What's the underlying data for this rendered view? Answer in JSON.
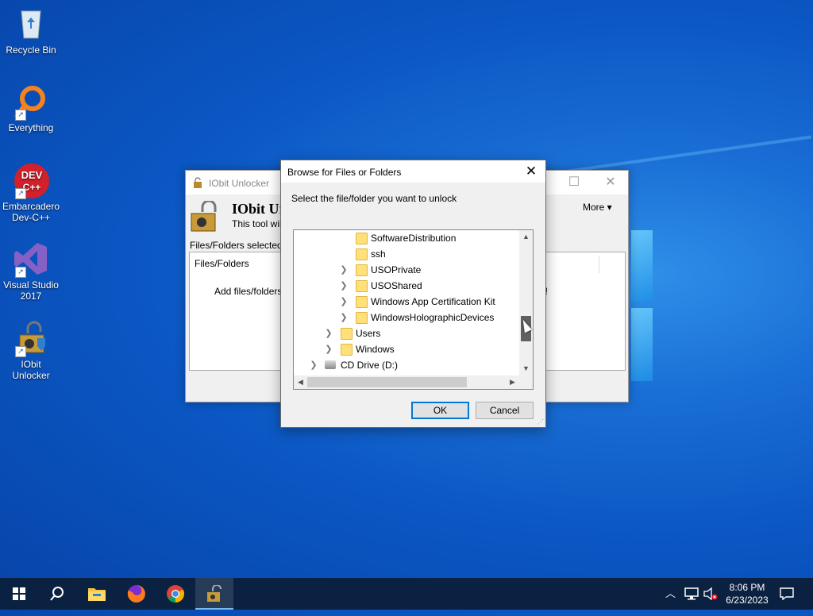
{
  "desktop": {
    "icons": [
      {
        "label": "Recycle Bin"
      },
      {
        "label": "Everything"
      },
      {
        "label": "Embarcadero Dev-C++",
        "badge": "DEV C++"
      },
      {
        "label": "Visual Studio 2017"
      },
      {
        "label": "IObit Unlocker"
      }
    ]
  },
  "main_window": {
    "title": "IObit Unlocker",
    "heading": "IObit Ur",
    "subtitle": "This tool will",
    "more_label": "More ▾",
    "files_section_label": "Files/Folders selected",
    "column_header": "Files/Folders",
    "hint_text": "Add files/folders t",
    "hint_tail": "n!"
  },
  "dialog": {
    "title": "Browse for Files or Folders",
    "prompt": "Select the file/folder you want to unlock",
    "tree": [
      {
        "label": "SoftwareDistribution",
        "level": 2,
        "expandable": false,
        "icon": "folder-icon"
      },
      {
        "label": "ssh",
        "level": 2,
        "expandable": false,
        "icon": "folder-icon"
      },
      {
        "label": "USOPrivate",
        "level": 2,
        "expandable": true,
        "icon": "folder-icon"
      },
      {
        "label": "USOShared",
        "level": 2,
        "expandable": true,
        "icon": "folder-icon"
      },
      {
        "label": "Windows App Certification Kit",
        "level": 2,
        "expandable": true,
        "icon": "folder-icon"
      },
      {
        "label": "WindowsHolographicDevices",
        "level": 2,
        "expandable": true,
        "icon": "folder-icon"
      },
      {
        "label": "Users",
        "level": 1,
        "expandable": true,
        "icon": "folder-icon"
      },
      {
        "label": "Windows",
        "level": 1,
        "expandable": true,
        "icon": "folder-icon"
      },
      {
        "label": "CD Drive (D:)",
        "level": 0,
        "expandable": true,
        "icon": "cd-drive-icon"
      }
    ],
    "ok_label": "OK",
    "cancel_label": "Cancel"
  },
  "taskbar": {
    "clock_time": "8:06 PM",
    "clock_date": "6/23/2023"
  },
  "colors": {
    "accent": "#0078d7",
    "taskbar": "#0a2142",
    "folder": "#ffe07a"
  }
}
